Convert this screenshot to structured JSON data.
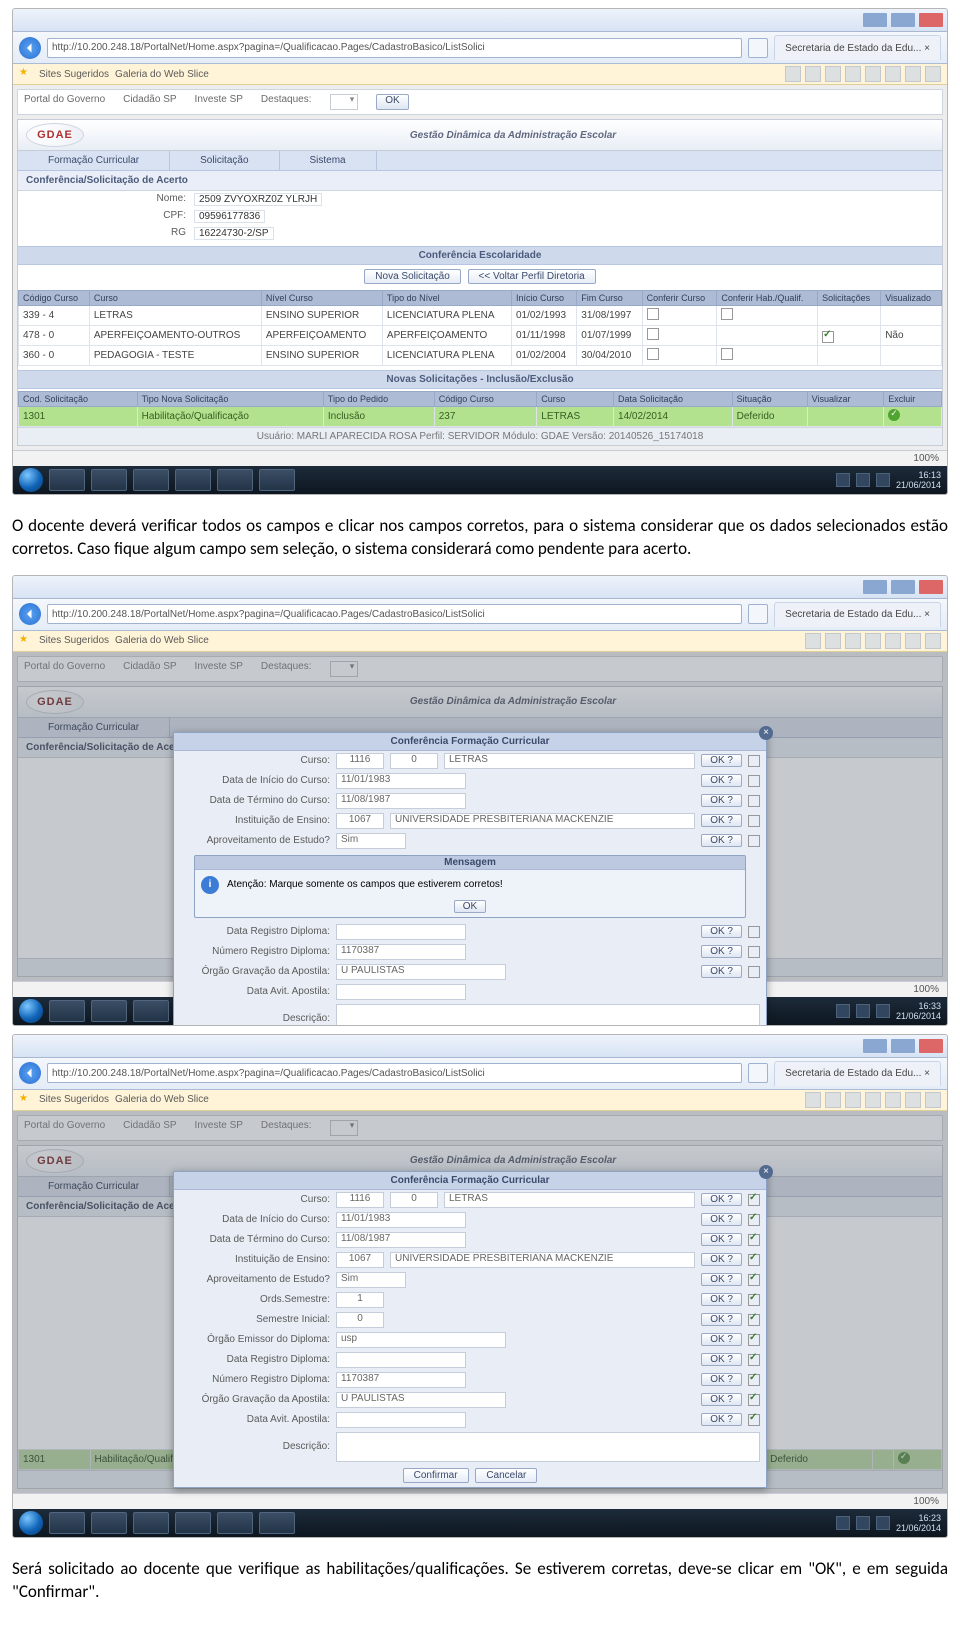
{
  "browser": {
    "url_display": "http://10.200.248.18/PortalNet/Home.aspx?pagina=/Qualificacao.Pages/CadastroBasico/ListSolici",
    "tab_title": "Secretaria de Estado da Edu... ×",
    "fav_sites": "Sites Sugeridos",
    "fav_gallery": "Galeria do Web Slice"
  },
  "crumb": {
    "c1": "Portal do Governo",
    "c2": "Cidadão SP",
    "c3": "Investe SP",
    "select": "Destaques:",
    "btn": "OK"
  },
  "app": {
    "title": "Gestão Dinâmica da Administração Escolar",
    "logo_text": "GDAE",
    "menu1": "Formação Curricular",
    "menu2": "Solicitação",
    "menu3": "Sistema"
  },
  "sec1": {
    "sub": "Conferência/Solicitação de Acerto",
    "nome_l": "Nome:",
    "nome_v": "2509 ZVYOXRZ0Z YLRJH",
    "cpf_l": "CPF:",
    "cpf_v": "09596177836",
    "rg_l": "RG",
    "rg_v": "16224730-2/SP"
  },
  "confbar": "Conferência Escolaridade",
  "btnbar": {
    "nova": "Nova Solicitação",
    "voltar": "<< Voltar Perfil Diretoria"
  },
  "thead": {
    "h1": "Código Curso",
    "h2": "Curso",
    "h3": "Nível Curso",
    "h4": "Tipo do Nível",
    "h5": "Início Curso",
    "h6": "Fim Curso",
    "h7": "Conferir Curso",
    "h8": "Conferir Hab./Qualif.",
    "h9": "Solicitações",
    "h10": "Visualizado"
  },
  "trows": [
    {
      "c": "339 - 4",
      "n": "LETRAS",
      "lv": "ENSINO SUPERIOR",
      "tp": "LICENCIATURA PLENA",
      "di": "01/02/1993",
      "df": "31/08/1997",
      "nao": ""
    },
    {
      "c": "478 - 0",
      "n": "APERFEIÇOAMENTO-OUTROS",
      "lv": "APERFEIÇOAMENTO",
      "tp": "APERFEIÇOAMENTO",
      "di": "01/11/1998",
      "df": "01/07/1999",
      "nao": "Não"
    },
    {
      "c": "360 - 0",
      "n": "PEDAGOGIA - TESTE",
      "lv": "ENSINO SUPERIOR",
      "tp": "LICENCIATURA PLENA",
      "di": "01/02/2004",
      "df": "30/04/2010",
      "nao": ""
    }
  ],
  "novasbar": "Novas Solicitações - Inclusão/Exclusão",
  "thead2": {
    "h1": "Cod. Solicitação",
    "h2": "Tipo Nova Solicitação",
    "h3": "Tipo do Pedido",
    "h4": "Código Curso",
    "h5": "Curso",
    "h6": "Data Solicitação",
    "h7": "Situação",
    "h8": "Visualizar",
    "h9": "Excluir"
  },
  "trow2": {
    "c": "1301",
    "t": "Habilitação/Qualificação",
    "p": "Inclusão",
    "cc": "237",
    "cu": "LETRAS",
    "ds": "14/02/2014",
    "sit": "Deferido"
  },
  "footer_info": "Usuário: MARLI APARECIDA ROSA   Perfil: SERVIDOR   Módulo: GDAE   Versão: 20140526_15174018",
  "zoom": "100%",
  "clock1": "16:13",
  "date1": "21/06/2014",
  "para1": "O docente deverá verificar todos os campos e clicar nos campos corretos, para o sistema considerar que os dados selecionados estão corretos. Caso fique algum campo sem seleção, o sistema considerará como pendente para acerto.",
  "modal": {
    "title": "Conferência Formação Curricular",
    "f_curso": "Curso:",
    "v_curso_code": "1116",
    "v_curso_sfx": "0",
    "v_curso_name": "LETRAS",
    "f_di": "Data de Início do Curso:",
    "v_di": "11/01/1983",
    "f_dt": "Data de Término do Curso:",
    "v_dt": "11/08/1987",
    "f_inst": "Instituição de Ensino:",
    "v_inst_code": "1067",
    "v_inst": "UNIVERSIDADE PRESBITERIANA MACKENZIE",
    "f_apr": "Aproveitamento de Estudo?",
    "v_apr": "Sim",
    "f_ords": "Ords.Semestre:",
    "f_sem": "Semestre Inicial:",
    "f_org": "Órgão Emissor do Diploma:",
    "f_reg": "Data Registro Diploma:",
    "f_numreg": "Número Registro Diploma:",
    "v_numreg": "1170387",
    "f_grav": "Órgão Gravação da Apostila:",
    "v_grav": "U PAULISTAS",
    "f_daa": "Data Avit. Apostila:",
    "f_desc": "Descrição:",
    "ok": "OK ?",
    "confirm": "Confirmar",
    "cancel": "Cancelar"
  },
  "msg": {
    "title": "Mensagem",
    "text": "Atenção: Marque somente os campos que estiverem corretos!",
    "ok": "OK"
  },
  "clock2": "16:33",
  "clock3": "16:23",
  "para2": "Será solicitado ao docente que verifique as habilitações/qualificações. Se estiverem corretas, deve-se clicar em \"OK\", e em seguida \"Confirmar\"."
}
